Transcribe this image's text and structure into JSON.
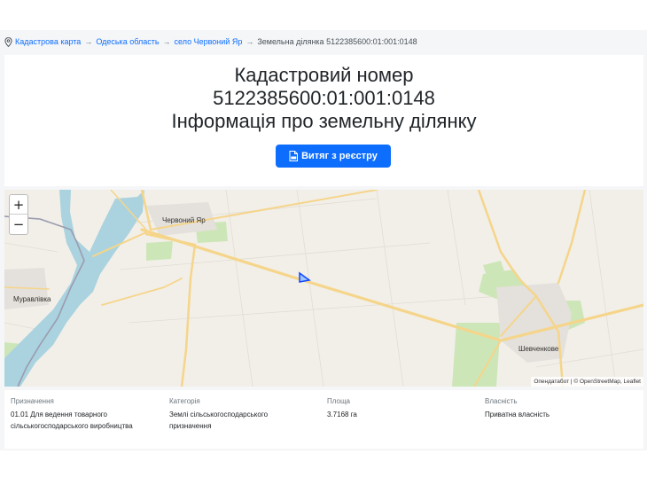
{
  "breadcrumb": {
    "items": [
      "Кадастрова карта",
      "Одеська область",
      "село Червоний Яр"
    ],
    "current": "Земельна ділянка 5122385600:01:001:0148",
    "separator": "→"
  },
  "header": {
    "line1": "Кадастровий номер",
    "line2": "5122385600:01:001:0148",
    "line3": "Інформація про земельну ділянку",
    "button_label": "Витяг з реєстру"
  },
  "map": {
    "zoom_in": "+",
    "zoom_out": "−",
    "labels": {
      "village_top": "Червоний Яр",
      "village_left": "Муравлівка",
      "village_right": "Шевченкове"
    },
    "attribution": "Опендатабот | © OpenStreetMap, Leaflet"
  },
  "info": {
    "purpose": {
      "label": "Призначення",
      "value": "01.01 Для ведення товарного сільськогосподарського виробництва"
    },
    "category": {
      "label": "Категорія",
      "value": "Землі сільськогосподарського призначення"
    },
    "area": {
      "label": "Площа",
      "value": "3.7168 га"
    },
    "ownership": {
      "label": "Власність",
      "value": "Приватна власність"
    }
  },
  "colors": {
    "accent": "#0d6efd",
    "water": "#aad3df",
    "road": "#f7d794",
    "field": "#f2efe9",
    "green": "#cde6b8"
  }
}
